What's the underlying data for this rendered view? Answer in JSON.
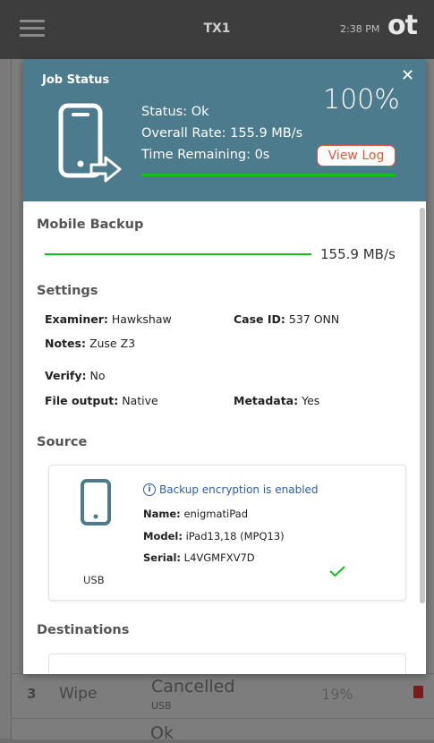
{
  "topbar": {
    "title": "TX1",
    "time": "2:38 PM",
    "logo": "ot"
  },
  "background_row": {
    "number": "3",
    "task": "Wipe",
    "status": "Cancelled",
    "status_sub": "USB",
    "percent": "19%"
  },
  "background_row_next": {
    "status": "Ok"
  },
  "modal": {
    "title": "Job Status",
    "percent": "100%",
    "status": "Status: Ok",
    "overall_rate": "Overall Rate: 155.9 MB/s",
    "time_remaining": "Time Remaining: 0s",
    "view_log": "View Log",
    "progress_fraction": 1.0,
    "colors": {
      "header": "#4d7b8e",
      "progress": "#14c01c",
      "accent": "#e5563a",
      "link": "#2c5ea8"
    }
  },
  "mobile_backup": {
    "title": "Mobile Backup",
    "rate": "155.9 MB/s"
  },
  "settings": {
    "title": "Settings",
    "examiner_label": "Examiner:",
    "examiner": "Hawkshaw",
    "case_label": "Case ID:",
    "case_id": "537 ONN",
    "notes_label": "Notes:",
    "notes": "Zuse Z3",
    "verify_label": "Verify:",
    "verify": "No",
    "file_output_label": "File output:",
    "file_output": "Native",
    "metadata_label": "Metadata:",
    "metadata": "Yes"
  },
  "source": {
    "title": "Source",
    "encryption": "Backup encryption is enabled",
    "name_label": "Name:",
    "name": "enigmatiPad",
    "model_label": "Model:",
    "model": "iPad13,18 (MPQ13)",
    "serial_label": "Serial:",
    "serial": "L4VGMFXV7D",
    "interface": "USB"
  },
  "destinations": {
    "title": "Destinations"
  }
}
